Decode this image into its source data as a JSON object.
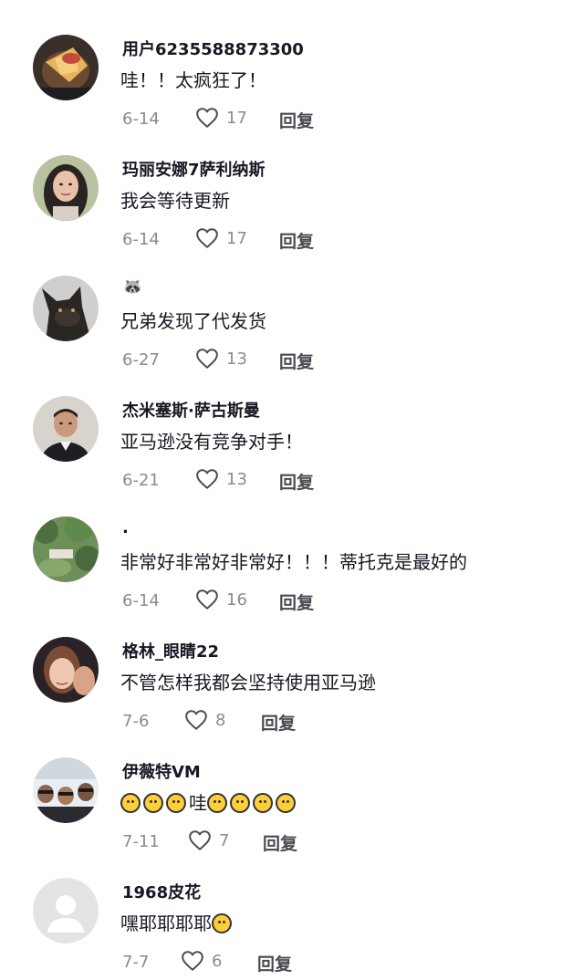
{
  "top_partial": "· ·",
  "reply_label": "回复",
  "colors": {
    "username": "#161823",
    "meta": "#8a8b91",
    "emoji_face": "#ffcf3a"
  },
  "comments": [
    {
      "username": "用户6235588873300",
      "text": "哇！！太疯狂了！",
      "date": "6-14",
      "likes": "17",
      "avatar_icon": "food-photo-avatar"
    },
    {
      "username": "玛丽安娜7萨利纳斯",
      "text": "我会等待更新",
      "date": "6-14",
      "likes": "17",
      "avatar_icon": "woman-portrait-avatar"
    },
    {
      "username": "🦝",
      "text": "兄弟发现了代发货",
      "date": "6-27",
      "likes": "13",
      "avatar_icon": "dog-photo-avatar"
    },
    {
      "username": "杰米塞斯·萨古斯曼",
      "text": "亚马逊没有竞争对手！",
      "date": "6-21",
      "likes": "13",
      "avatar_icon": "man-portrait-avatar"
    },
    {
      "username": ".",
      "text": "非常好非常好非常好！！！蒂托克是最好的",
      "date": "6-14",
      "likes": "16",
      "avatar_icon": "landscape-photo-avatar"
    },
    {
      "username": "格林_眼睛22",
      "text": "不管怎样我都会坚持使用亚马逊",
      "date": "7-6",
      "likes": "8",
      "avatar_icon": "selfie-photo-avatar"
    },
    {
      "username": "伊薇特VM",
      "text_after": "哇",
      "emoji_before": 3,
      "emoji_after": 4,
      "date": "7-11",
      "likes": "7",
      "avatar_icon": "group-photo-avatar"
    },
    {
      "username": "1968皮花",
      "text": "嘿耶耶耶耶",
      "emoji_after": 1,
      "date": "7-7",
      "likes": "6",
      "avatar_icon": "default-user-avatar"
    }
  ]
}
